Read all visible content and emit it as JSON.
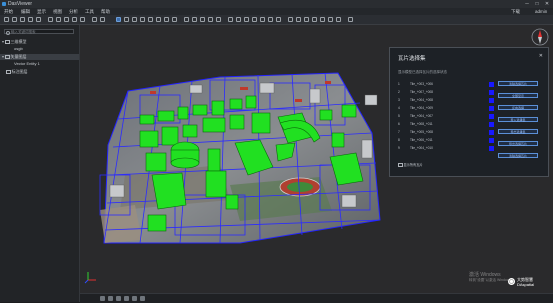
{
  "window": {
    "title": "DasViewer",
    "min_glyph": "─",
    "max_glyph": "□",
    "close_glyph": "✕"
  },
  "menu": {
    "items": [
      "开始",
      "编辑",
      "显示",
      "视图",
      "分析",
      "工具",
      "帮助"
    ],
    "download_label": "下载",
    "user_label": "admin"
  },
  "left_panel": {
    "search_placeholder": "输入关键词搜索",
    "tree": [
      {
        "label": "三维模型"
      },
      {
        "label": "osgb"
      },
      {
        "label": "矢量图层"
      },
      {
        "label": "Vector Entity 1"
      },
      {
        "label": "标注图层"
      }
    ]
  },
  "dialog": {
    "title": "瓦片选择集",
    "close_glyph": "✕",
    "subtitle": "显示模型已选择瓦片的选择状态",
    "rows": [
      {
        "num": "1",
        "name": "Tile_+003_+006"
      },
      {
        "num": "2",
        "name": "Tile_+007_+008"
      },
      {
        "num": "3",
        "name": "Tile_+004_+008"
      },
      {
        "num": "4",
        "name": "Tile_+004_+009"
      },
      {
        "num": "5",
        "name": "Tile_+004_+007"
      },
      {
        "num": "6",
        "name": "Tile_+008_+011"
      },
      {
        "num": "7",
        "name": "Tile_+005_+008"
      },
      {
        "num": "8",
        "name": "Tile_+006_+011"
      },
      {
        "num": "9",
        "name": "Tile_+004_+010"
      }
    ],
    "buttons": [
      "清除选择瓦片",
      "全部显示",
      "反向选择",
      "导入选择集",
      "导出选择集",
      "导出选择瓦片",
      "清除选择瓦片"
    ],
    "footer": "显示所有瓦片",
    "swatch_color": "#1818ff"
  },
  "overlay": {
    "watermark_line1": "激活 Windows",
    "watermark_line2": "转到\"设置\"以激活 Windows。",
    "logo_line1": "大势智慧",
    "logo_line2": "DAspatial"
  }
}
